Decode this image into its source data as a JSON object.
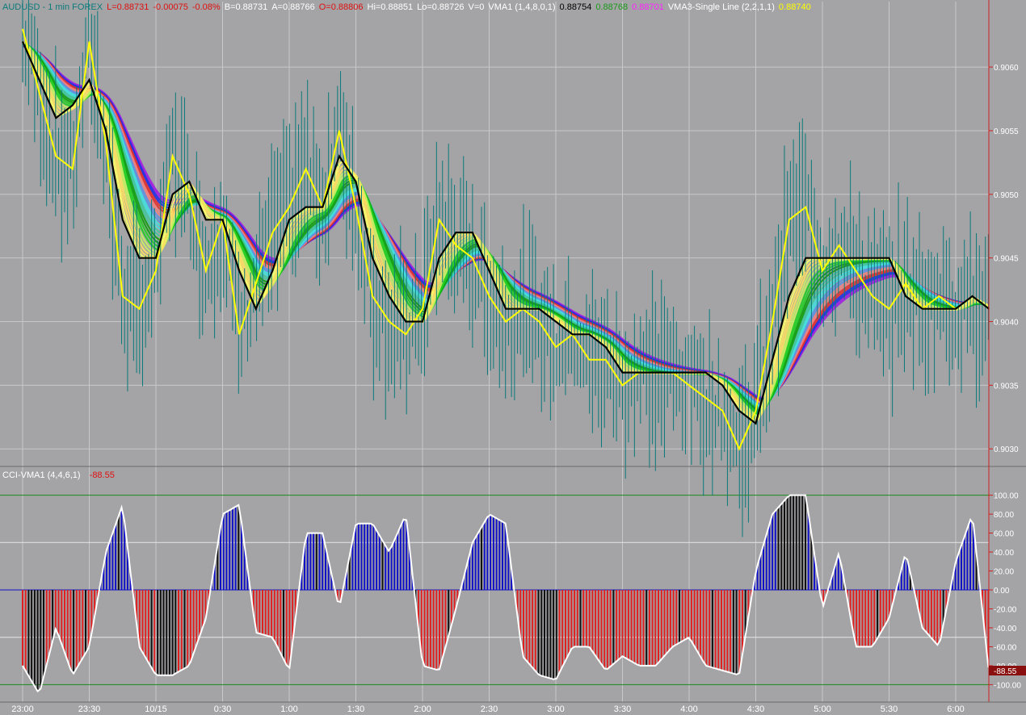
{
  "header": {
    "parts": [
      {
        "text": "AUDUSD - 1 min  FOREX",
        "color": "#0b7a7a"
      },
      {
        "text": "L=0.88731",
        "color": "#e01010"
      },
      {
        "text": "-0.00075",
        "color": "#e01010"
      },
      {
        "text": "-0.08%",
        "color": "#e01010"
      },
      {
        "text": "B=0.88731",
        "color": "#ffffff"
      },
      {
        "text": "A=0.88766",
        "color": "#ffffff"
      },
      {
        "text": "O=0.88806",
        "color": "#e01010"
      },
      {
        "text": "Hi=0.88851",
        "color": "#ffffff"
      },
      {
        "text": "Lo=0.88726",
        "color": "#ffffff"
      },
      {
        "text": "V=0",
        "color": "#ffffff"
      },
      {
        "text": "VMA1 (1,4,8,0,1)",
        "color": "#ffffff"
      },
      {
        "text": "0.88754",
        "color": "#000000"
      },
      {
        "text": "0.88768",
        "color": "#1a9a1a"
      },
      {
        "text": "0.88701",
        "color": "#ff20ff"
      },
      {
        "text": "VMA3-Single Line (2,2,1,1)",
        "color": "#ffffff"
      },
      {
        "text": "0.88740",
        "color": "#ffff00"
      }
    ]
  },
  "lower_header": {
    "label": "CCI-VMA1 (4,4,6,1)",
    "value": "-88.55"
  },
  "current_value_badge": "-88.55",
  "colors": {
    "background": "#a4a4a6",
    "positive_bar": "#1010c8",
    "negative_bar": "#e02020",
    "neutral_bar": "#101010",
    "cci_line": "#ffffff",
    "vma_black": "#000000",
    "vma_yellow": "#ffff00",
    "axis_red": "#d02020",
    "level_green": "#1a8a1a",
    "price_ticks": "#0a7a7a"
  },
  "chart_data": [
    {
      "type": "line",
      "title": "AUDUSD - 1 min  FOREX",
      "x": [
        "23:00",
        "23:30",
        "10/15",
        "0:30",
        "1:00",
        "1:30",
        "2:00",
        "2:30",
        "3:00",
        "3:30",
        "4:00",
        "4:30",
        "5:00",
        "5:30",
        "6:00"
      ],
      "ylim": [
        0.9029,
        0.9064
      ],
      "yticks": [
        "0.9060",
        "0.9055",
        "0.9050",
        "0.9045",
        "0.9040",
        "0.9035",
        "0.9030"
      ],
      "grid": true,
      "series": [
        {
          "name": "VMA1",
          "color": "#000000",
          "x": [
            0,
            0.25,
            0.5,
            0.75,
            1.0,
            1.25,
            1.5,
            1.75,
            2.0,
            2.25,
            2.5,
            2.75,
            3.0,
            3.25,
            3.5,
            3.75,
            4.0,
            4.25,
            4.5,
            4.75,
            5.0,
            5.25,
            5.5,
            5.75,
            6.0,
            6.25,
            6.5,
            6.75,
            7.0,
            7.25,
            7.5,
            7.75,
            8.0,
            8.25,
            8.5,
            8.75,
            9.0,
            9.25,
            9.5,
            9.75,
            10.0,
            10.25,
            10.5,
            10.75,
            11.0,
            11.25,
            11.5,
            11.75,
            12.0,
            12.25,
            12.5,
            12.75,
            13.0,
            13.25,
            13.5,
            13.75,
            14.0,
            14.25,
            14.5
          ],
          "values": [
            0.9062,
            0.9059,
            0.9056,
            0.9057,
            0.9059,
            0.9055,
            0.9048,
            0.9045,
            0.9045,
            0.905,
            0.9051,
            0.9048,
            0.9048,
            0.9044,
            0.9041,
            0.9044,
            0.9048,
            0.9049,
            0.9049,
            0.9053,
            0.9051,
            0.9045,
            0.9042,
            0.904,
            0.904,
            0.9045,
            0.9047,
            0.9047,
            0.9044,
            0.9041,
            0.9041,
            0.9041,
            0.904,
            0.9039,
            0.9039,
            0.9038,
            0.9036,
            0.9036,
            0.9036,
            0.9036,
            0.9036,
            0.9036,
            0.9035,
            0.9033,
            0.9032,
            0.9037,
            0.9042,
            0.9045,
            0.9045,
            0.9045,
            0.9045,
            0.9045,
            0.9045,
            0.9042,
            0.9041,
            0.9041,
            0.9041,
            0.9042,
            0.9041
          ]
        },
        {
          "name": "VMA3-Single Line",
          "color": "#ffff00",
          "x": [
            0,
            0.25,
            0.5,
            0.75,
            1.0,
            1.25,
            1.5,
            1.75,
            2.0,
            2.25,
            2.5,
            2.75,
            3.0,
            3.25,
            3.5,
            3.75,
            4.0,
            4.25,
            4.5,
            4.75,
            5.0,
            5.25,
            5.5,
            5.75,
            6.0,
            6.25,
            6.5,
            6.75,
            7.0,
            7.25,
            7.5,
            7.75,
            8.0,
            8.25,
            8.5,
            8.75,
            9.0,
            9.25,
            9.5,
            9.75,
            10.0,
            10.25,
            10.5,
            10.75,
            11.0,
            11.25,
            11.5,
            11.75,
            12.0,
            12.25,
            12.5,
            12.75,
            13.0,
            13.25,
            13.5,
            13.75,
            14.0,
            14.25,
            14.5
          ],
          "values": [
            0.9063,
            0.9058,
            0.9053,
            0.9052,
            0.9062,
            0.9054,
            0.9042,
            0.9041,
            0.9044,
            0.9053,
            0.905,
            0.9044,
            0.9048,
            0.9039,
            0.9043,
            0.9047,
            0.9049,
            0.9052,
            0.9049,
            0.9055,
            0.9049,
            0.9042,
            0.904,
            0.9039,
            0.9041,
            0.9048,
            0.9046,
            0.9045,
            0.9042,
            0.904,
            0.9041,
            0.904,
            0.9038,
            0.9039,
            0.9037,
            0.9037,
            0.9035,
            0.9036,
            0.9036,
            0.9036,
            0.9035,
            0.9034,
            0.9033,
            0.903,
            0.9033,
            0.904,
            0.9048,
            0.9049,
            0.9044,
            0.9046,
            0.9044,
            0.9042,
            0.9041,
            0.9043,
            0.9041,
            0.9042,
            0.9041,
            0.9042,
            0.9041
          ]
        }
      ]
    },
    {
      "type": "bar",
      "title": "CCI-VMA1 (4,4,6,1)",
      "ylim": [
        -115,
        115
      ],
      "yticks": [
        "100.00",
        "80.00",
        "60.00",
        "40.00",
        "20.00",
        "0.00",
        "-20.00",
        "-40.00",
        "-60.00",
        "-80.00",
        "-100.00"
      ],
      "levels": [
        100,
        50,
        0,
        -50,
        -100
      ],
      "x": [
        0,
        0.25,
        0.5,
        0.75,
        1.0,
        1.25,
        1.5,
        1.75,
        2.0,
        2.25,
        2.5,
        2.75,
        3.0,
        3.25,
        3.5,
        3.75,
        4.0,
        4.25,
        4.5,
        4.75,
        5.0,
        5.25,
        5.5,
        5.75,
        6.0,
        6.25,
        6.5,
        6.75,
        7.0,
        7.25,
        7.5,
        7.75,
        8.0,
        8.25,
        8.5,
        8.75,
        9.0,
        9.25,
        9.5,
        9.75,
        10.0,
        10.25,
        10.5,
        10.75,
        11.0,
        11.25,
        11.5,
        11.75,
        12.0,
        12.25,
        12.5,
        12.75,
        13.0,
        13.25,
        13.5,
        13.75,
        14.0,
        14.25,
        14.5
      ],
      "values": [
        -80,
        -110,
        -40,
        -90,
        -60,
        40,
        90,
        -60,
        -90,
        -90,
        -80,
        -30,
        80,
        90,
        -45,
        -50,
        -85,
        60,
        60,
        -20,
        70,
        70,
        40,
        80,
        -80,
        -85,
        -20,
        50,
        80,
        70,
        -70,
        -90,
        -95,
        -60,
        -60,
        -85,
        -70,
        -80,
        -80,
        -60,
        -50,
        -80,
        -85,
        -90,
        20,
        80,
        100,
        100,
        -20,
        40,
        -60,
        -60,
        -30,
        40,
        -40,
        -60,
        30,
        80,
        -88.55
      ]
    }
  ]
}
